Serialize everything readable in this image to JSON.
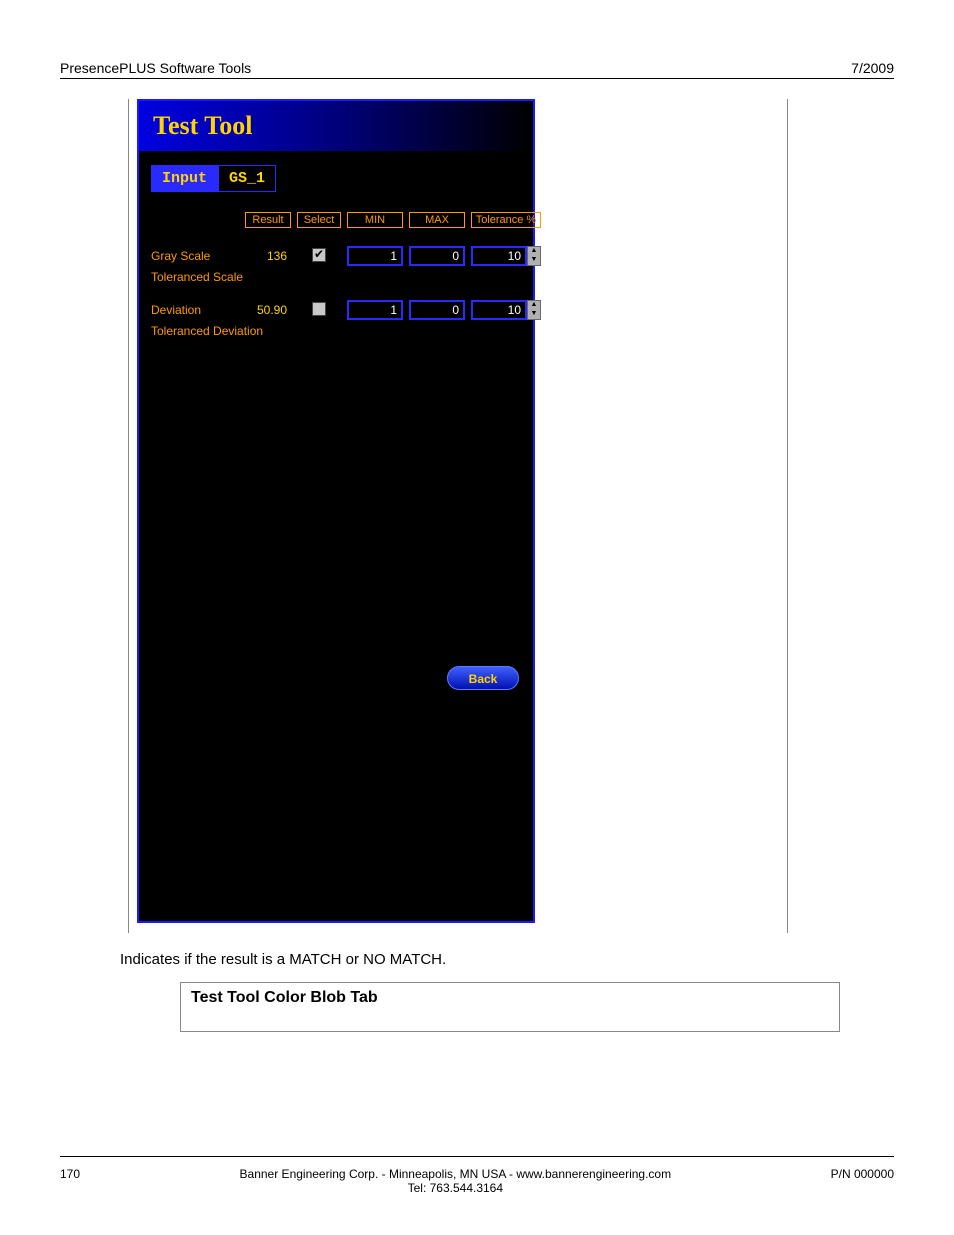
{
  "header": {
    "left": "PresencePLUS Software Tools",
    "right": "7/2009"
  },
  "panel": {
    "title": "Test Tool",
    "tabs": {
      "active": "Input",
      "inactive": "GS_1"
    },
    "columns": {
      "result": "Result",
      "select": "Select",
      "min": "MIN",
      "max": "MAX",
      "tol": "Tolerance %"
    },
    "rows": {
      "grayscale": {
        "label": "Gray Scale",
        "result": "136",
        "min": "1",
        "max": "0",
        "tol": "10",
        "sub": "Toleranced Scale"
      },
      "deviation": {
        "label": "Deviation",
        "result": "50.90",
        "min": "1",
        "max": "0",
        "tol": "10",
        "sub": "Toleranced Deviation"
      }
    },
    "back": "Back"
  },
  "caption": "Indicates if the result is a MATCH or NO MATCH.",
  "section": {
    "title": "Test Tool Color Blob Tab"
  },
  "footer": {
    "page": "170",
    "center1": "Banner Engineering Corp. - Minneapolis, MN USA - www.bannerengineering.com",
    "center2": "Tel: 763.544.3164",
    "right": "P/N 000000"
  }
}
